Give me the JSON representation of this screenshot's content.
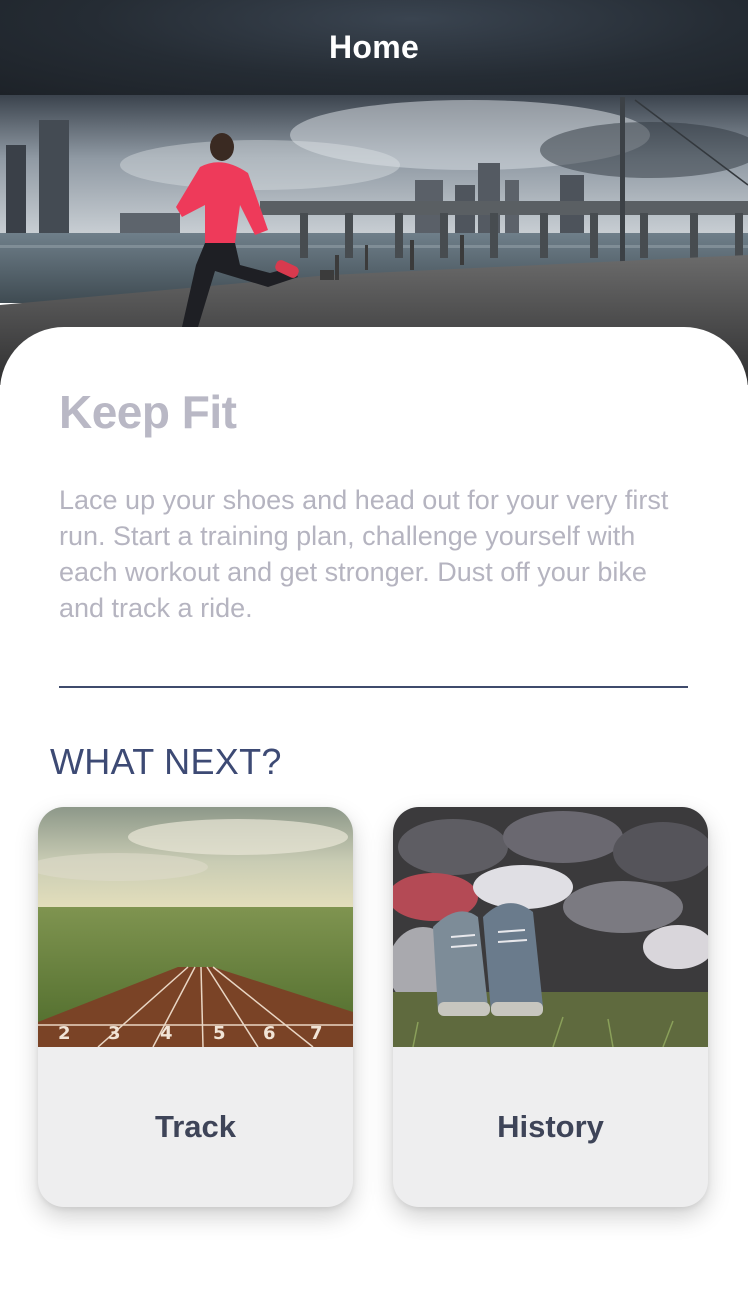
{
  "nav": {
    "title": "Home"
  },
  "hero": {
    "image": "runner-by-waterfront-bridge-photo"
  },
  "intro": {
    "headline": "Keep Fit",
    "description": "Lace up your shoes and head out for your very first run. Start a training plan, challenge yourself with each workout and get stronger. Dust off your bike and track a ride."
  },
  "next": {
    "title": "WHAT NEXT?",
    "tiles": [
      {
        "label": "Track",
        "image": "running-track-lanes-photo"
      },
      {
        "label": "History",
        "image": "pile-of-running-shoes-photo"
      }
    ]
  },
  "colors": {
    "nav_bg": "#252c34",
    "headline": "#b9b8c5",
    "body_text": "#b5b4c0",
    "accent": "#3d4a74",
    "tile_bg": "#eeeeef"
  }
}
